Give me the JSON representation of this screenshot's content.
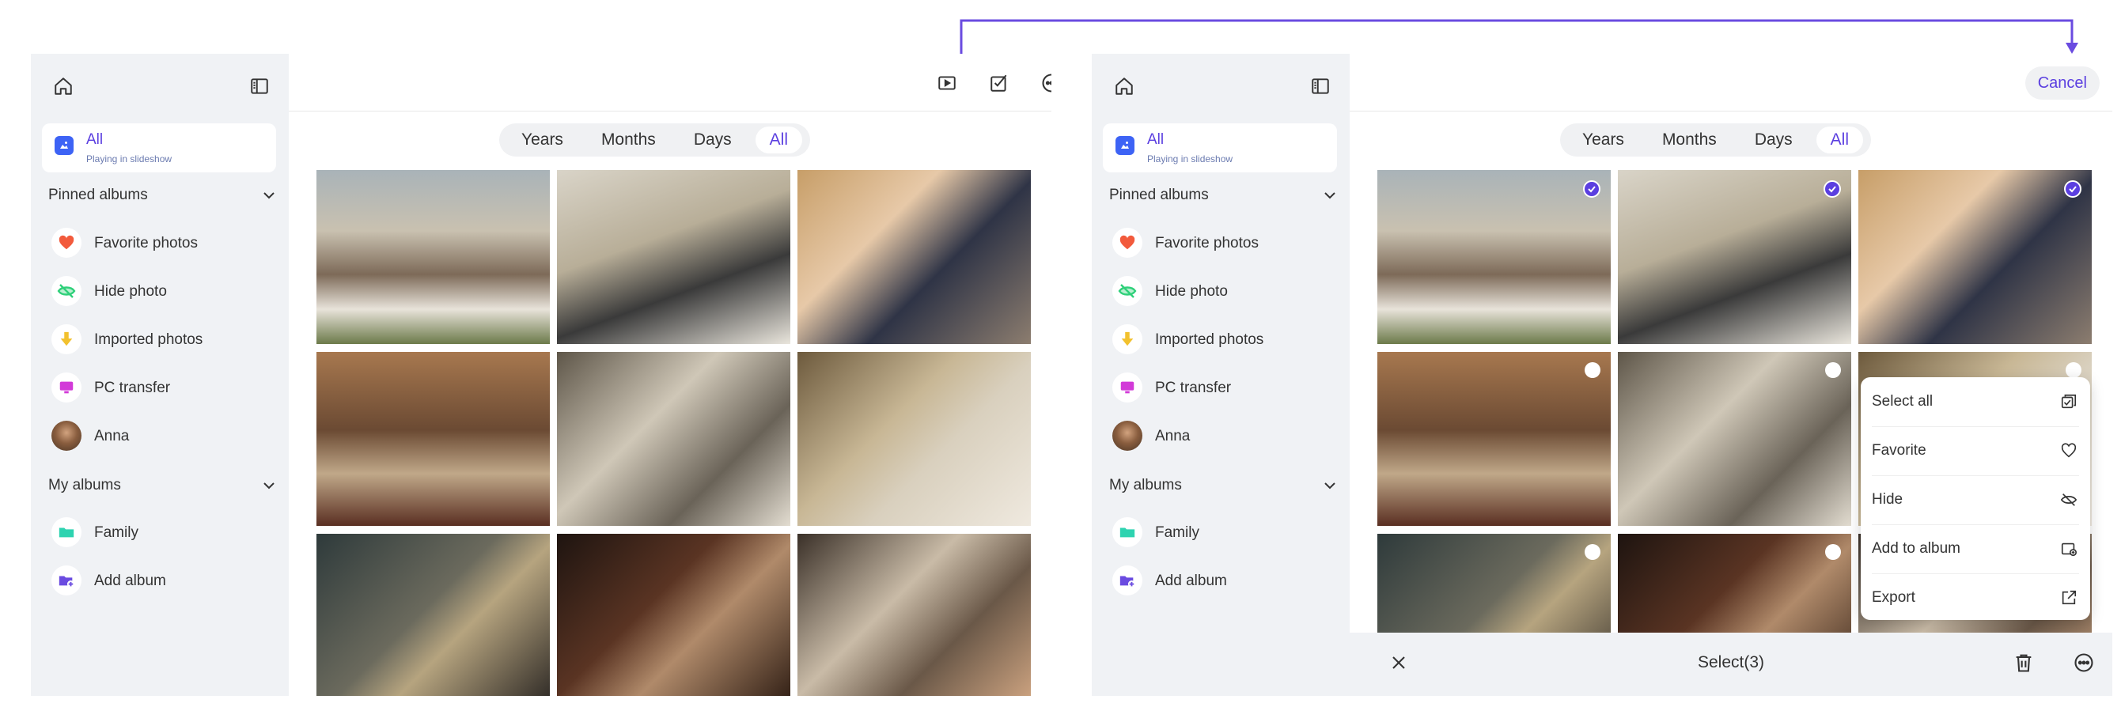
{
  "accent": "#5b3fe0",
  "sidebar": {
    "selected": {
      "title": "All",
      "subtitle": "Playing in slideshow"
    },
    "pinned_header": "Pinned albums",
    "pinned": [
      {
        "label": "Favorite photos",
        "icon": "heart-icon"
      },
      {
        "label": "Hide photo",
        "icon": "hidden-eye-icon"
      },
      {
        "label": "Imported photos",
        "icon": "download-arrow-icon"
      },
      {
        "label": "PC transfer",
        "icon": "monitor-icon"
      },
      {
        "label": "Anna",
        "icon": "avatar"
      }
    ],
    "myalbums_header": "My albums",
    "albums": [
      {
        "label": "Family",
        "icon": "folder-icon"
      },
      {
        "label": "Add album",
        "icon": "add-folder-icon"
      }
    ]
  },
  "segments": [
    "Years",
    "Months",
    "Days",
    "All"
  ],
  "selected_segment": "All",
  "select_mode": {
    "cancel_label": "Cancel",
    "status": "Select(3)",
    "menu": [
      "Select all",
      "Favorite",
      "Hide",
      "Add to album",
      "Export"
    ]
  }
}
